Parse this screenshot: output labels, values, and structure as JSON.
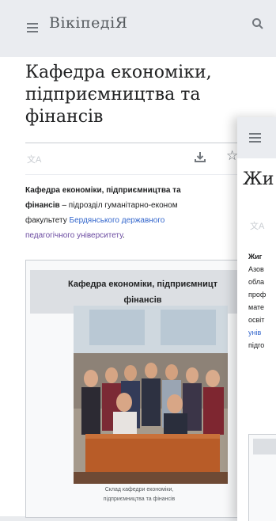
{
  "header": {
    "logo": "ВікіпедіЯ"
  },
  "article": {
    "title_lines": [
      "Кафедра економіки,",
      "підприємництва та",
      "фінансів"
    ],
    "lead": {
      "bold_1": "Кафедра економіки, підприємництва та",
      "bold_2": "фінансів",
      "text_1": " – підрозділ гуманітарно-економ",
      "text_2": "факультету ",
      "link_1": "Бердянського державного",
      "link_2": "педагогічного університету",
      "tail": "."
    },
    "infobox": {
      "title_lines": [
        "Кафедра економіки, підприємницт",
        "фінансів"
      ],
      "caption_lines": [
        "Склад кафедри економіки,",
        "підприємництва та фінансів"
      ]
    }
  },
  "second_card": {
    "title": "Жи",
    "lines": [
      {
        "text": "Жиг",
        "style": "bold"
      },
      {
        "text": "Азов",
        "style": "normal"
      },
      {
        "text": "обла",
        "style": "normal"
      },
      {
        "text": "проф",
        "style": "normal"
      },
      {
        "text": "мате",
        "style": "normal"
      },
      {
        "text": "освіт",
        "style": "normal"
      },
      {
        "text": "унів",
        "style": "link"
      },
      {
        "text": "підго",
        "style": "normal"
      }
    ]
  },
  "icons": {
    "menu": "menu-icon",
    "search": "search-icon",
    "translate": "language-icon",
    "download": "download-icon",
    "watch": "star-icon"
  },
  "colors": {
    "link": "#3366cc",
    "visited_link": "#6b4ba1",
    "header_bg": "#eaecf0",
    "text": "#202122"
  }
}
